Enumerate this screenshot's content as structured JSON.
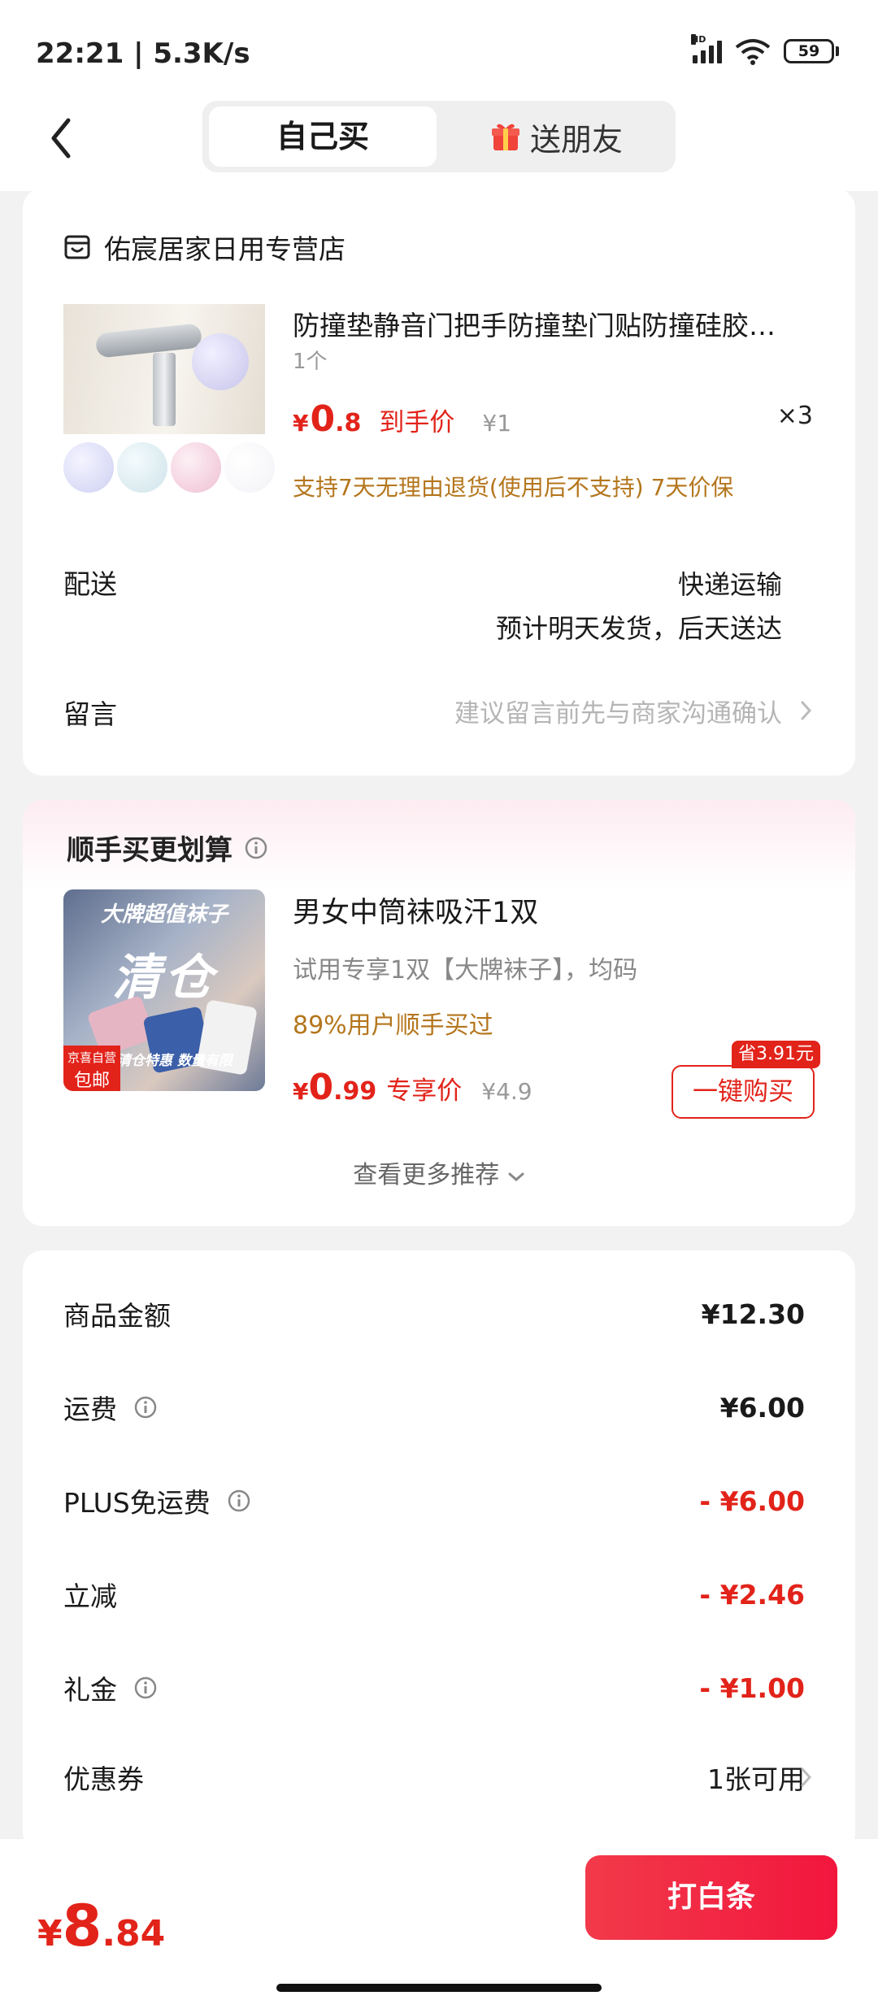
{
  "status": {
    "time": "22:21 | 5.3K/s",
    "signal_label": "HD",
    "battery": "59"
  },
  "header": {
    "tab_self": "自己买",
    "tab_gift": "送朋友"
  },
  "shop": {
    "name": "佑宸居家日用专营店"
  },
  "product": {
    "title": "防撞垫静音门把手防撞垫门贴防撞硅胶…",
    "spec": "1个",
    "currency": "¥",
    "price_int": "0",
    "price_dec": ".8",
    "price_tag": "到手价",
    "original_price": "¥1",
    "quantity": "×3",
    "service": "支持7天无理由退货(使用后不支持)  7天价保",
    "ball_colors": [
      "#cfd0f2",
      "#cfe3ea",
      "#efc0d3",
      "#f3f1f6"
    ]
  },
  "delivery": {
    "label": "配送",
    "method": "快递运输",
    "eta": "预计明天发货，后天送达"
  },
  "message": {
    "label": "留言",
    "placeholder": "建议留言前先与商家沟通确认"
  },
  "recommend": {
    "section_title": "顺手买更划算",
    "img_banner": "大牌超值袜子",
    "img_big": "清仓",
    "img_sub": "清仓特惠 数量有限",
    "img_badge_top": "京喜自营",
    "img_badge_bottom": "包邮",
    "name": "男女中筒袜吸汗1双",
    "desc": "试用专享1双【大牌袜子】，均码",
    "percent": "89%用户顺手买过",
    "currency": "¥",
    "price_int": "0",
    "price_dec": ".99",
    "price_tag": "专享价",
    "original_price": "¥4.9",
    "save_tag": "省3.91元",
    "buy_button": "一键购买",
    "more": "查看更多推荐"
  },
  "summary": {
    "rows": [
      {
        "label": "商品金额",
        "value": "¥12.30"
      },
      {
        "label": "运费",
        "value": "¥6.00"
      },
      {
        "label": "PLUS免运费",
        "value": "- ¥6.00"
      },
      {
        "label": "立减",
        "value": "- ¥2.46"
      },
      {
        "label": "礼金",
        "value": "- ¥1.00"
      },
      {
        "label": "优惠券",
        "value": "1张可用"
      }
    ]
  },
  "footer": {
    "currency": "¥",
    "total_int": "8",
    "total_dec": ".84",
    "pay_button": "打白条"
  },
  "colors": {
    "accent": "#e2231a",
    "pay_button": "#f2163d",
    "service_text": "#b4761c"
  }
}
